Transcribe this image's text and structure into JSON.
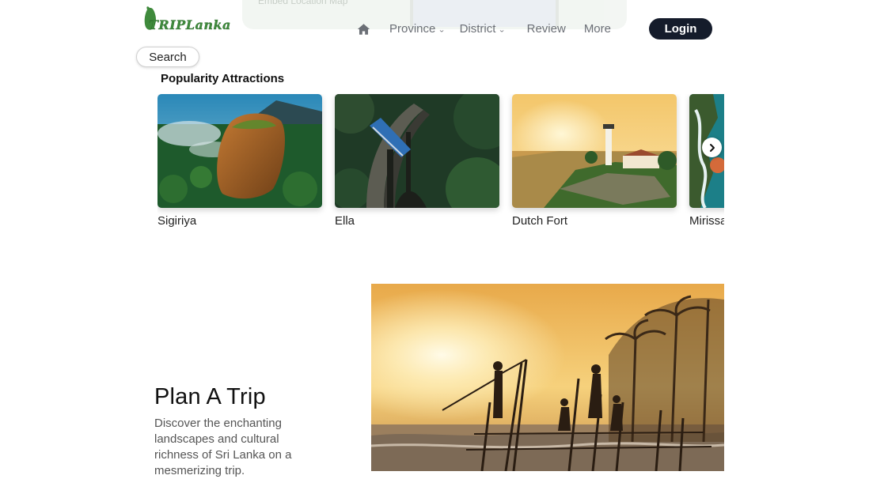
{
  "embed": {
    "label": "Embed Location Map"
  },
  "brand": {
    "logo_text": "TRIPLanka",
    "color": "#3f8a3c"
  },
  "nav": {
    "home_icon": "home-icon",
    "items": [
      {
        "label": "Province",
        "has_dropdown": true
      },
      {
        "label": "District",
        "has_dropdown": true
      },
      {
        "label": "Review",
        "has_dropdown": false
      },
      {
        "label": "More",
        "has_dropdown": false
      }
    ],
    "login_label": "Login"
  },
  "search": {
    "label": "Search"
  },
  "attractions": {
    "title": "Popularity Attractions",
    "items": [
      {
        "name": "Sigiriya",
        "image": "sigiriya-rock-aerial"
      },
      {
        "name": "Ella",
        "image": "ella-nine-arch-bridge-train"
      },
      {
        "name": "Dutch Fort",
        "image": "galle-fort-lighthouse"
      },
      {
        "name": "Mirissa",
        "image": "mirissa-coast-aerial"
      }
    ],
    "next_icon": "chevron-right-icon"
  },
  "plan": {
    "title": "Plan A Trip",
    "description": "Discover the enchanting landscapes and cultural richness of Sri Lanka on a mesmerizing trip.",
    "image": "stilt-fishermen-sunset"
  },
  "colors": {
    "dark_button": "#151c2b",
    "nav_text": "#6b6f76"
  }
}
